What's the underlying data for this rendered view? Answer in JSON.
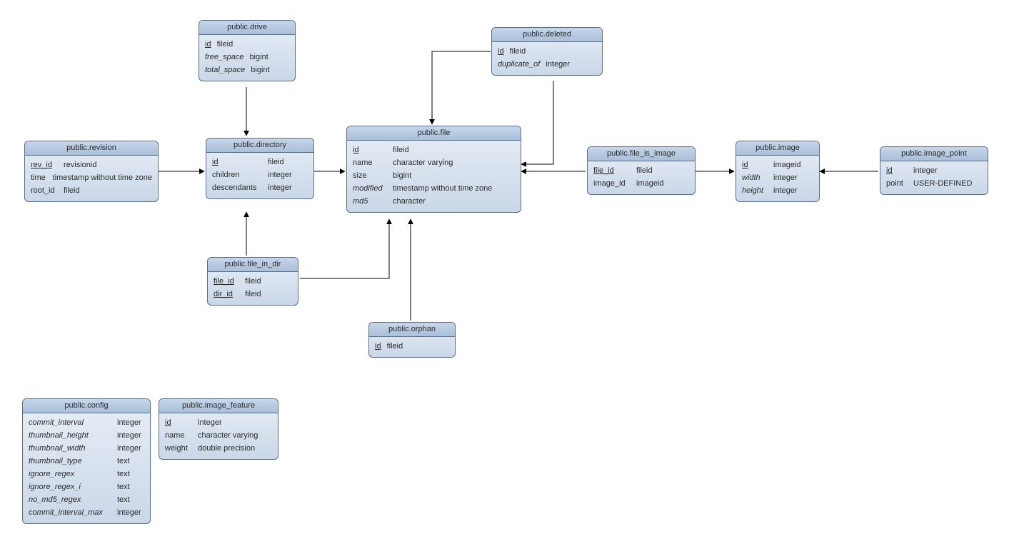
{
  "tables": {
    "drive": {
      "title": "public.drive",
      "rows": [
        {
          "name": "id",
          "type": "fileid",
          "pk": true
        },
        {
          "name": "free_space",
          "type": "bigint",
          "nullable": true
        },
        {
          "name": "total_space",
          "type": "bigint",
          "nullable": true
        }
      ]
    },
    "deleted": {
      "title": "public.deleted",
      "rows": [
        {
          "name": "id",
          "type": "fileid",
          "pk": true
        },
        {
          "name": "duplicate_of",
          "type": "integer",
          "nullable": true
        }
      ]
    },
    "revision": {
      "title": "public.revision",
      "rows": [
        {
          "name": "rev_id",
          "type": "revisionid",
          "pk": true
        },
        {
          "name": "time",
          "type": "timestamp without time zone"
        },
        {
          "name": "root_id",
          "type": "fileid"
        }
      ]
    },
    "directory": {
      "title": "public.directory",
      "rows": [
        {
          "name": "id",
          "type": "fileid",
          "pk": true
        },
        {
          "name": "children",
          "type": "integer"
        },
        {
          "name": "descendants",
          "type": "integer"
        }
      ]
    },
    "file": {
      "title": "public.file",
      "rows": [
        {
          "name": "id",
          "type": "fileid",
          "pk": true
        },
        {
          "name": "name",
          "type": "character varying"
        },
        {
          "name": "size",
          "type": "bigint"
        },
        {
          "name": "modified",
          "type": "timestamp without time zone",
          "nullable": true
        },
        {
          "name": "md5",
          "type": "character",
          "nullable": true
        }
      ]
    },
    "file_is_image": {
      "title": "public.file_is_image",
      "rows": [
        {
          "name": "file_id",
          "type": "fileid",
          "pk": true
        },
        {
          "name": "image_id",
          "type": "imageid"
        }
      ]
    },
    "image": {
      "title": "public.image",
      "rows": [
        {
          "name": "id",
          "type": "imageid",
          "pk": true
        },
        {
          "name": "width",
          "type": "integer",
          "nullable": true
        },
        {
          "name": "height",
          "type": "integer",
          "nullable": true
        }
      ]
    },
    "image_point": {
      "title": "public.image_point",
      "rows": [
        {
          "name": "id",
          "type": "integer",
          "pk": true
        },
        {
          "name": "point",
          "type": "USER-DEFINED"
        }
      ]
    },
    "file_in_dir": {
      "title": "public.file_in_dir",
      "rows": [
        {
          "name": "file_id",
          "type": "fileid",
          "pk": true
        },
        {
          "name": "dir_id",
          "type": "fileid",
          "pk": true
        }
      ]
    },
    "orphan": {
      "title": "public.orphan",
      "rows": [
        {
          "name": "id",
          "type": "fileid",
          "pk": true
        }
      ]
    },
    "config": {
      "title": "public.config",
      "rows": [
        {
          "name": "commit_interval",
          "type": "integer",
          "nullable": true
        },
        {
          "name": "thumbnail_height",
          "type": "integer",
          "nullable": true
        },
        {
          "name": "thumbnail_width",
          "type": "integer",
          "nullable": true
        },
        {
          "name": "thumbnail_type",
          "type": "text",
          "nullable": true
        },
        {
          "name": "ignore_regex",
          "type": "text",
          "nullable": true
        },
        {
          "name": "ignore_regex_i",
          "type": "text",
          "nullable": true
        },
        {
          "name": "no_md5_regex",
          "type": "text",
          "nullable": true
        },
        {
          "name": "commit_interval_max",
          "type": "integer",
          "nullable": true
        }
      ]
    },
    "image_feature": {
      "title": "public.image_feature",
      "rows": [
        {
          "name": "id",
          "type": "integer",
          "pk": true
        },
        {
          "name": "name",
          "type": "character varying"
        },
        {
          "name": "weight",
          "type": "double precision"
        }
      ]
    }
  }
}
